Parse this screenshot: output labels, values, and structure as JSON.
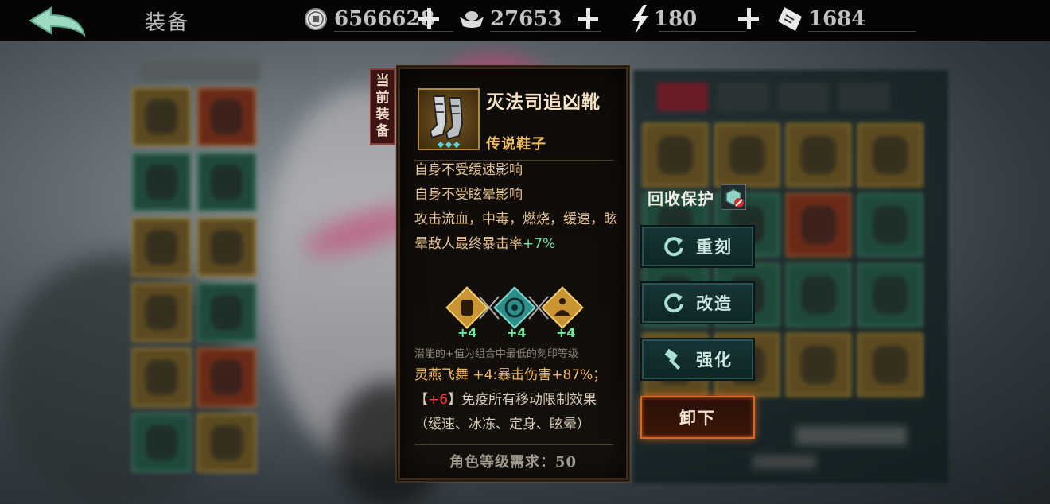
{
  "header": {
    "title": "装备",
    "resources": [
      {
        "icon": "coin-icon",
        "value": "6566628"
      },
      {
        "icon": "silver-ingot-icon",
        "value": "27653"
      },
      {
        "icon": "energy-bolt-icon",
        "value": "180"
      },
      {
        "icon": "ticket-icon",
        "value": "1684"
      }
    ]
  },
  "tooltip": {
    "tag": [
      "当",
      "前",
      "装",
      "备"
    ],
    "item_name": "灭法司追凶靴",
    "rarity": "传说鞋子",
    "effects": [
      "自身不受缓速影响",
      "自身不受眩晕影响",
      "攻击流血，中毒，燃烧，缓速，眩",
      "晕敌人最终暴击率"
    ],
    "effect_bonus": "+7%",
    "runes": [
      {
        "icon": "fist-rune-icon",
        "value": "+4"
      },
      {
        "icon": "eye-rune-icon",
        "value": "+4"
      },
      {
        "icon": "meditation-rune-icon",
        "value": "+4"
      }
    ],
    "rune_note": "潜能的+值为组合中最低的刻印等级",
    "set_name": "灵燕飞舞",
    "set_level_bonus": "+4:暴击伤害+87%；",
    "set_bracket_open": "【",
    "set_red_value": "+6",
    "set_bracket_close": "】",
    "set_effect": "免疫所有移动限制效果",
    "set_effect_detail": "（缓速、冰冻、定身、眩晕）",
    "level_requirement": "角色等级需求：50"
  },
  "actions": {
    "protect_label": "回收保护",
    "reforge": "重刻",
    "modify": "改造",
    "enhance": "强化",
    "unequip": "卸下"
  },
  "colors": {
    "accent_gold": "#f1c15f",
    "bonus_green": "#6fe49c",
    "set_red": "#f24040",
    "unequip_glow": "#e0651c"
  }
}
